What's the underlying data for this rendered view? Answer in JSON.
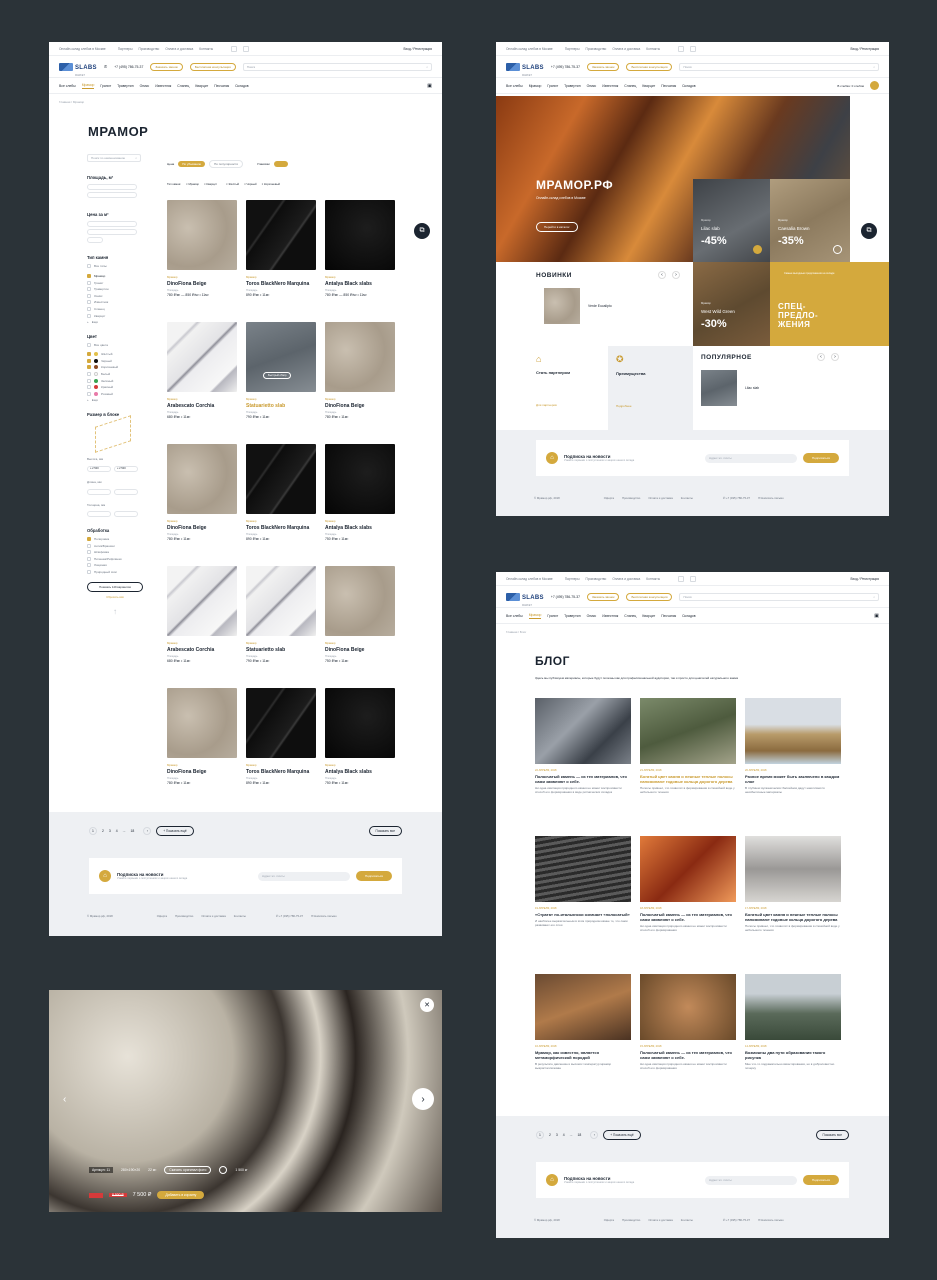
{
  "header": {
    "tagline": "Онлайн-склад слебов в Москве",
    "links": [
      "Партнеры",
      "Производство",
      "Оплата и доставка",
      "Контакты"
    ],
    "login": "Вход / Регистрация",
    "logo": "SLABS",
    "logo_sub": "MARKET",
    "phone": "+7 (495) 786-75-37",
    "btn_call": "Заказать звонок",
    "btn_consult": "Бесплатная консультация",
    "search_placeholder": "Поиск",
    "nav": [
      "Все слебы",
      "Мрамор",
      "Гранит",
      "Травертин",
      "Оникс",
      "Известняк",
      "Сланец",
      "Кварцит",
      "Песчаник",
      "Складов"
    ]
  },
  "catalog": {
    "crumb": "Главная / Мрамор",
    "title": "МРАМОР",
    "search_placeholder": "Поиск по наименованию",
    "sort_label": "Цена",
    "sort_btn": "По убыванию",
    "sort_alt": "По популярности",
    "sort_view": "Упаковки",
    "filters": {
      "area": "Площадь, м²",
      "price": "Цена за м²",
      "type": "Тип камня",
      "color": "Цвет",
      "size": "Размер в блоке",
      "height": "Высота, мм",
      "width": "Длина, мм",
      "thick": "Толщина, мм",
      "finish": "Обработка",
      "type_items": [
        "Все типы",
        "Мрамор",
        "Гранит",
        "Травертин",
        "Оникс",
        "Известняк",
        "Сланец",
        "Кварцит",
        "Ещё"
      ],
      "color_items": [
        "Все цвета",
        "Жёлтый",
        "Чёрный",
        "Коричневый",
        "Белый",
        "Зелёный",
        "Красный",
        "Розовый",
        "Ещё"
      ],
      "finish_items": [
        "Полировка",
        "Антик/Брашинг",
        "Шлифовка",
        "Пиленая/Рифлёная",
        "Лощёная",
        "Природный скол"
      ],
      "show": "Показать 149 вариантов",
      "reset": "Сбросить всё",
      "h_from": "≥ 2 500",
      "h_to": "≤ 2 500"
    },
    "chips_label": "Тип камня:",
    "chips": [
      "Мрамор",
      "Кварцит",
      "Жёлтый",
      "Чёрный",
      "Коричневый"
    ],
    "products": [
      {
        "cat": "Мрамор",
        "name": "DinoFiona Beige",
        "label": "Площадь",
        "price": "780 ₽/м² — 850 ₽/м² • 11м²"
      },
      {
        "cat": "Мрамор",
        "name": "Toros BlackNero Marquina",
        "label": "Площадь",
        "price": "890 ₽/м² • 11м²"
      },
      {
        "cat": "Мрамор",
        "name": "Antalya Black slabs",
        "label": "Площадь",
        "price": "780 ₽/м² — 850 ₽/м² • 11м²"
      },
      {
        "cat": "Мрамор",
        "name": "Arabescato Corchia",
        "label": "Площадь",
        "price": "680 ₽/м² • 11м²"
      },
      {
        "cat": "Мрамор",
        "name": "Statuarietto slab",
        "label": "Площадь",
        "price": "790 ₽/м² • 11м²"
      },
      {
        "cat": "Мрамор",
        "name": "DinoFiona Beige",
        "label": "Площадь",
        "price": "780 ₽/м² • 11м²"
      },
      {
        "cat": "Мрамор",
        "name": "DinoFiona Beige",
        "label": "Площадь",
        "price": "780 ₽/м² • 11м²"
      },
      {
        "cat": "Мрамор",
        "name": "Toros BlackNero Marquina",
        "label": "Площадь",
        "price": "890 ₽/м² • 11м²"
      },
      {
        "cat": "Мрамор",
        "name": "Antalya Black slabs",
        "label": "Площадь",
        "price": "750 ₽/м² • 11м²"
      },
      {
        "cat": "Мрамор",
        "name": "Arabescato Corchia",
        "label": "Площадь",
        "price": "680 ₽/м² • 11м²"
      },
      {
        "cat": "Мрамор",
        "name": "Statuarietto slab",
        "label": "Площадь",
        "price": "790 ₽/м² • 11м²"
      },
      {
        "cat": "Мрамор",
        "name": "DinoFiona Beige",
        "label": "Площадь",
        "price": "750 ₽/м² • 11м²"
      },
      {
        "cat": "Мрамор",
        "name": "DinoFiona Beige",
        "label": "Площадь",
        "price": "780 ₽/м² • 11м²"
      },
      {
        "cat": "Мрамор",
        "name": "Toros BlackNero Marquina",
        "label": "Площадь",
        "price": "890 ₽/м² • 11м²"
      },
      {
        "cat": "Мрамор",
        "name": "Antalya Black slabs",
        "label": "Площадь",
        "price": "750 ₽/м² • 11м²"
      }
    ],
    "hover_btn": "Быстрый обзор",
    "pages": [
      "1",
      "2",
      "3",
      "4",
      "...",
      "18"
    ],
    "more": "Показать ещё",
    "all": "Показать все"
  },
  "subscribe": {
    "title": "Подписка на новости",
    "text": "Узнайте первыми о поступлениях и акциях нашего склада",
    "placeholder": "Адрес эл. почты",
    "btn": "Подписаться"
  },
  "footer": {
    "copy": "© Мрамор.рф, 2018",
    "links": [
      "Оферта",
      "Производство",
      "Оплата и доставка",
      "Контакты"
    ],
    "phone": "+7 (495) 786-75-37",
    "mail": "Написать письмо"
  },
  "home": {
    "hero_title": "МРАМОР.РФ",
    "hero_sub": "Онлайн-склад слебов в Москве",
    "hero_btn": "Перейти в каталог",
    "cart": "В слебах: 0 слебов",
    "promos": [
      {
        "cat": "Мрамор",
        "name": "Lilac slab",
        "pct": "-45%"
      },
      {
        "cat": "Мрамор",
        "name": "Caesalia Brown",
        "pct": "-35%"
      },
      {
        "cat": "Мрамор",
        "name": "West Wild Green",
        "pct": "-30%"
      }
    ],
    "special": "СПЕЦ-ПРЕДЛО-ЖЕНИЯ",
    "special_sub": "Самые выгодные предложения на складе",
    "new_title": "НОВИНКИ",
    "new_item": "Verde Eucalipto",
    "pop_title": "ПОПУЛЯРНОЕ",
    "pop_item": "Lilac slab",
    "partner": "Стать партнером",
    "partner_link": "Для партнеров",
    "adv": "Преимущества",
    "adv_link": "Подробнее"
  },
  "blog": {
    "crumb": "Главная / Блог",
    "title": "БЛОГ",
    "intro": "Здесь мы публикуем материалы, которые будут полезны как для профессиональной аудитории, так и просто для ценителей натурального камня",
    "posts": [
      {
        "date": "22 АПРЕЛЯ, 2018",
        "title": "Полосчатый камень — из тех материалов, что сами заявляют о себе.",
        "text": "Ни одна имитация природного камня не может воспроизвести способ его формирования в виде ритмических складок"
      },
      {
        "date": "21 АПРЕЛЯ, 2018",
        "title": "Богатый цвет камня и нежные теплые полосы напоминают годовые кольца дорогого дерева",
        "text": "Полосы привнес, что позволит в формировании в спокойной воде у небольшого течения"
      },
      {
        "date": "20 АПРЕЛЯ, 2018",
        "title": "Разное время может быть заключено в каждом слое",
        "text": "В глубинах вулканических бассейнов дадут накопляются неизбыпочные материалы"
      },
      {
        "date": "19 АПРЕЛЯ, 2018",
        "title": "«Страта» по-итальянски означает «полосатый»",
        "text": "И наиболее выразительным в этом природном камне то, что сами развивают его слои"
      },
      {
        "date": "18 АПРЕЛЯ, 2018",
        "title": "Полосчатый камень — из тех материалов, что сами заявляют о себе.",
        "text": "Ни одна имитация природного камня не может воспроизвести способ его формирования"
      },
      {
        "date": "17 АПРЕЛЯ, 2018",
        "title": "Богатый цвет камня и нежные теплые полосы напоминают годовые кольца дорогого дерева",
        "text": "Полосы привнес, что позволит в формировании в спокойной воде у небольшого течения"
      },
      {
        "date": "16 АПРЕЛЯ, 2018",
        "title": "Мрамор, как известно, является метаморфической породой",
        "text": "В результате давлению и высоких температур мрамор выкристаллизован"
      },
      {
        "date": "15 АПРЕЛЯ, 2018",
        "title": "Полосчатый камень — из тех материалов, что сами заявляют о себе.",
        "text": "Ни одна имитация природного камня не может воспроизвести способ его формирования"
      },
      {
        "date": "14 АПРЕЛЯ, 2018",
        "title": "Возможны два пути образования такого рисунка",
        "text": "Мне что-то подражательно вмонтирования, но в добросовестно почерку"
      }
    ]
  },
  "viewer": {
    "code": "Артикул: 11",
    "size": "280×190×20",
    "area": "22 м²",
    "btn": "Скачать оригинал фото",
    "weight": "1 500 кг",
    "old": "8 500 ₽",
    "price": "7 500 ₽",
    "add": "Добавить в корзину"
  }
}
